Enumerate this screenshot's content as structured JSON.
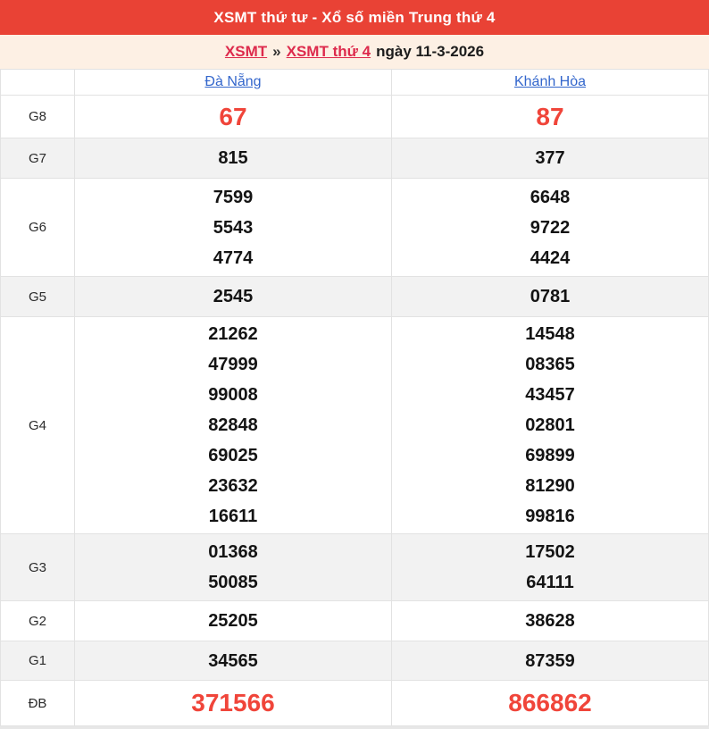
{
  "header": {
    "title": "XSMT thứ tư - Xổ số miền Trung thứ 4"
  },
  "breadcrumb": {
    "link_xsmt": "XSMT",
    "separator": "»",
    "link_day": "XSMT thứ 4",
    "date_text": "ngày 11-3-2026"
  },
  "table": {
    "columns": [
      "Đà Nẵng",
      "Khánh Hòa"
    ],
    "rows": [
      {
        "label": "G8",
        "danang": [
          "67"
        ],
        "khanhhoa": [
          "87"
        ]
      },
      {
        "label": "G7",
        "danang": [
          "815"
        ],
        "khanhhoa": [
          "377"
        ]
      },
      {
        "label": "G6",
        "danang": [
          "7599",
          "5543",
          "4774"
        ],
        "khanhhoa": [
          "6648",
          "9722",
          "4424"
        ]
      },
      {
        "label": "G5",
        "danang": [
          "2545"
        ],
        "khanhhoa": [
          "0781"
        ]
      },
      {
        "label": "G4",
        "danang": [
          "21262",
          "47999",
          "99008",
          "82848",
          "69025",
          "23632",
          "16611"
        ],
        "khanhhoa": [
          "14548",
          "08365",
          "43457",
          "02801",
          "69899",
          "81290",
          "99816"
        ]
      },
      {
        "label": "G3",
        "danang": [
          "01368",
          "50085"
        ],
        "khanhhoa": [
          "17502",
          "64111"
        ]
      },
      {
        "label": "G2",
        "danang": [
          "25205"
        ],
        "khanhhoa": [
          "38628"
        ]
      },
      {
        "label": "G1",
        "danang": [
          "34565"
        ],
        "khanhhoa": [
          "87359"
        ]
      },
      {
        "label": "ĐB",
        "danang": [
          "371566"
        ],
        "khanhhoa": [
          "866862"
        ]
      }
    ]
  },
  "colors": {
    "titlebar_bg": "#e94235",
    "breadcrumb_bg": "#fdf0e4",
    "breadcrumb_link": "#dd2a4c",
    "province_link": "#3366cc",
    "highlight_number": "#f0453a",
    "alt_row_bg": "#f2f2f2",
    "border": "#e2e2e2"
  }
}
